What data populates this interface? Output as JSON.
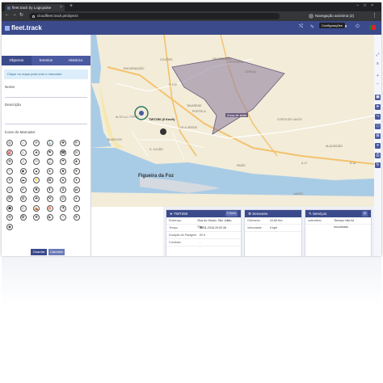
{
  "browser": {
    "tab_title": "fleet.track by Logicpulse",
    "url": "cloudfleet.track.pt/objects",
    "incognito_label": "Navegação anónima (2)"
  },
  "app": {
    "logo": "fleet.track",
    "tooltip": "Configurações",
    "accent": "#3b4a8b"
  },
  "panel": {
    "tabs": [
      "Objectos",
      "Eventos",
      "Histórico"
    ],
    "info": "Clique no mapa para criar o marcador.",
    "name_label": "Nome",
    "description_label": "Descrição",
    "icon_label": "Ícone do Marcador",
    "save_button": "Guardar",
    "cancel_button": "Cancelar"
  },
  "map": {
    "vehicle_label": "TWT250 (0 Km/h)",
    "city": "Figueira da Foz",
    "zone_label": "Zona de teste",
    "zone_color": "#8a7a9c",
    "places": [
      "COVÕES",
      "CERCAL",
      "SALTADOURO",
      "FERREIRA",
      "PORTELA",
      "TAVAREDE",
      "VILA VERDE",
      "LAVOS",
      "ALTO DO FORTE",
      "ENCARNAÇÃO",
      "BUARCOS",
      "S. JULIÃO",
      "PAIÃO",
      "COSTA DE LAVOS",
      "ALQUEIDÃO",
      "A 17",
      "A 14",
      "N 109"
    ]
  },
  "cards": {
    "vehicle": {
      "title": "TWT250",
      "badge": "0 Km/h",
      "rows": [
        {
          "k": "Endereço",
          "v": "Rua do Gesso, São Julião, Figu..."
        },
        {
          "k": "Tempo",
          "v": "26-11-2018 20:02:36"
        },
        {
          "k": "Duração de Paragem",
          "v": "22 h"
        },
        {
          "k": "Condutor",
          "v": "-"
        }
      ]
    },
    "sensors": {
      "title": "Sensores",
      "rows": [
        {
          "k": "Odómetro",
          "v": "41.84 Km"
        },
        {
          "k": "Velocidade",
          "v": "0 kph"
        }
      ]
    },
    "services": {
      "title": "Serviços",
      "rows": [
        {
          "k": "calendário",
          "v": "'Serviço' não foi encontrado"
        }
      ]
    }
  }
}
